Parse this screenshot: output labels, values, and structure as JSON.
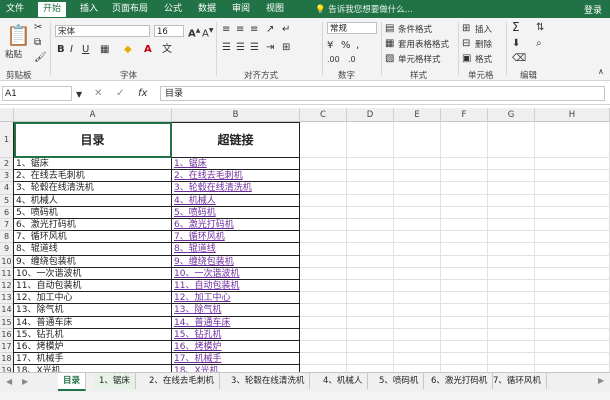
{
  "menu": {
    "file": "文件",
    "tabs": [
      "开始",
      "插入",
      "页面布局",
      "公式",
      "数据",
      "审阅",
      "视图"
    ],
    "search": "告诉我您想要做什么...",
    "login": "登录"
  },
  "ribbon": {
    "paste": "粘贴",
    "font_name": "宋体",
    "font_size": "16",
    "number_format": "常规",
    "conditional": "条件格式",
    "table_format": "套用表格格式",
    "cell_style": "单元格样式",
    "insert": "插入",
    "delete": "删除",
    "format": "格式",
    "groups": [
      "剪贴板",
      "字体",
      "对齐方式",
      "数字",
      "样式",
      "单元格",
      "编辑"
    ]
  },
  "formula": {
    "name_box": "A1",
    "fx": "fx",
    "value": "目录"
  },
  "sheet": {
    "columns": [
      "A",
      "B",
      "C",
      "D",
      "E",
      "F",
      "G",
      "H"
    ],
    "row_numbers": [
      "1",
      "2",
      "3",
      "4",
      "5",
      "6",
      "7",
      "8",
      "9",
      "10",
      "11",
      "12",
      "13",
      "14",
      "15",
      "16",
      "17",
      "18",
      "19"
    ],
    "header_a": "目录",
    "header_b": "超链接",
    "col_a": [
      "1、锯床",
      "2、在线去毛刺机",
      "3、轮毂在线清洗机",
      "4、机械人",
      "5、喷码机",
      "6、激光打码机",
      "7、循环风机",
      "8、辊道线",
      "9、缠绕包装机",
      "10、一次谐波机",
      "11、自动包装机",
      "12、加工中心",
      "13、除气机",
      "14、普通车床",
      "15、钻孔机",
      "16、烤模炉",
      "17、机械手",
      "18、X光机"
    ],
    "col_b": [
      "1、锯床",
      "2、在线去毛刺机",
      "3、轮毂在线清洗机",
      "4、机械人",
      "5、喷码机",
      "6、激光打码机",
      "7、循环风机",
      "8、辊道线",
      "9、缠绕包装机",
      "10、一次谐波机",
      "11、自动包装机",
      "12、加工中心",
      "13、除气机",
      "14、普通车床",
      "15、钻孔机",
      "16、烤模炉",
      "17、机械手",
      "18、X光机"
    ]
  },
  "sheet_tabs": [
    "目录",
    "1、锯床",
    "2、在线去毛刺机",
    "3、轮毂在线清洗机",
    "4、机械人",
    "5、喷码机",
    "6、激光打码机",
    "7、循环风机"
  ],
  "colors": {
    "accent": "#217346",
    "link": "#7030a0"
  }
}
